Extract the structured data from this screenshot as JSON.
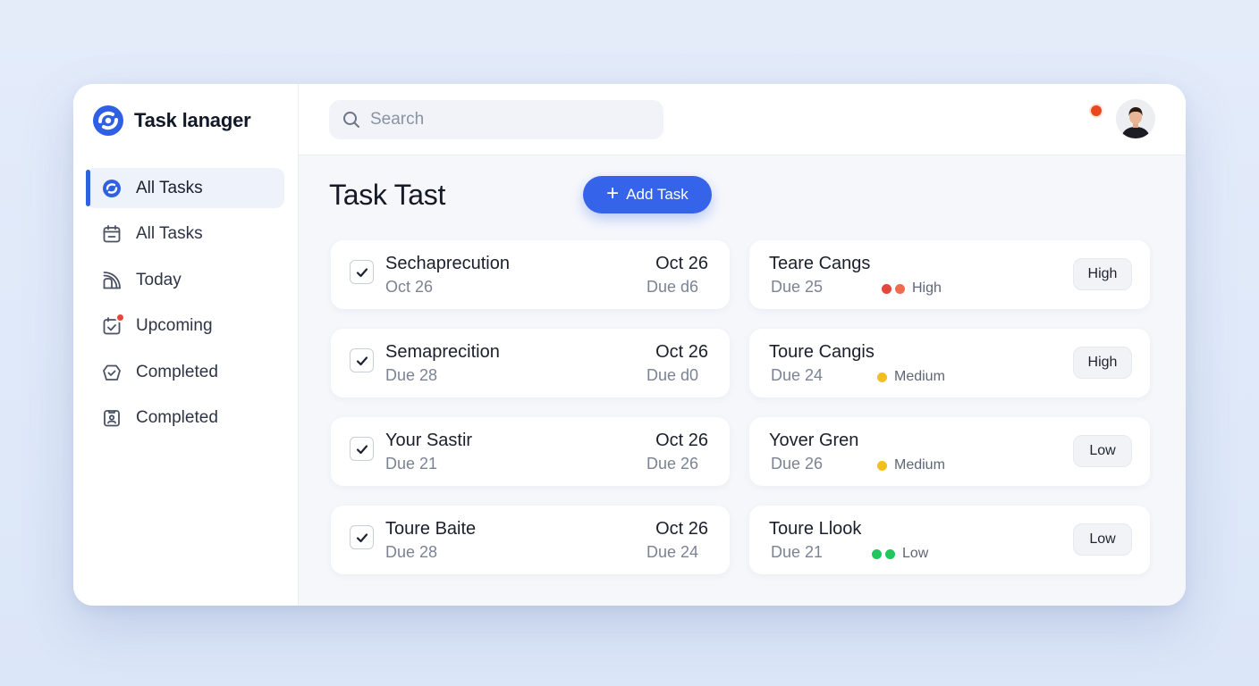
{
  "app": {
    "title": "Task lanager"
  },
  "sidebar": {
    "items": [
      {
        "label": "All Tasks",
        "icon": "brand-swirl-icon",
        "active": true
      },
      {
        "label": "All Tasks",
        "icon": "calendar-icon",
        "active": false
      },
      {
        "label": "Today",
        "icon": "signal-icon",
        "active": false
      },
      {
        "label": "Upcoming",
        "icon": "calendar-check-icon",
        "active": false,
        "badge": true
      },
      {
        "label": "Completed",
        "icon": "clock-check-icon",
        "active": false
      },
      {
        "label": "Completed",
        "icon": "clipboard-user-icon",
        "active": false
      }
    ]
  },
  "search": {
    "placeholder": "Search",
    "value": ""
  },
  "main": {
    "title": "Task Tast",
    "add_button": "Add Task"
  },
  "tasks_left": [
    {
      "title": "Sechaprecution",
      "subtitle": "Oct 26",
      "date": "Oct 26",
      "due": "Due d6"
    },
    {
      "title": "Semaprecition",
      "subtitle": "Due 28",
      "date": "Oct 26",
      "due": "Due d0"
    },
    {
      "title": "Your Sastir",
      "subtitle": "Due 21",
      "date": "Oct 26",
      "due": "Due 26"
    },
    {
      "title": "Toure Baite",
      "subtitle": "Due 28",
      "date": "Oct 26",
      "due": "Due 24"
    }
  ],
  "tasks_right": [
    {
      "title": "Teare Cangs",
      "due": "Due 25",
      "priority": "High",
      "dot_colors": [
        "#e5453b",
        "#ee6b4e"
      ],
      "badge": "High"
    },
    {
      "title": "Toure Cangis",
      "due": "Due 24",
      "priority": "Medium",
      "dot_colors": [
        "#f2c01e"
      ],
      "badge": "High"
    },
    {
      "title": "Yover Gren",
      "due": "Due 26",
      "priority": "Medium",
      "dot_colors": [
        "#f2c01e"
      ],
      "badge": "Low"
    },
    {
      "title": "Toure Llook",
      "due": "Due 21",
      "priority": "Low",
      "dot_colors": [
        "#22c55e",
        "#22c55e"
      ],
      "badge": "Low"
    }
  ],
  "colors": {
    "accent": "#3563e9",
    "active_bg": "#eef2fa",
    "notification": "#e8453c"
  }
}
